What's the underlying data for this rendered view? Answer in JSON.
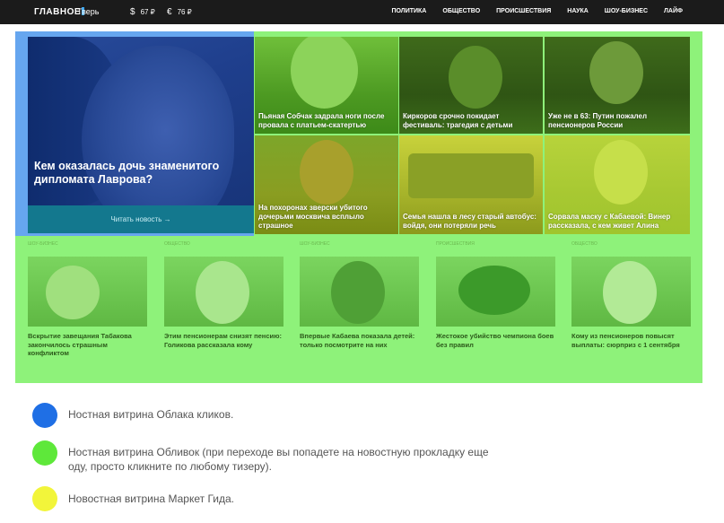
{
  "header": {
    "logo": "ГЛАВНОЕ",
    "city": "Тверь",
    "rates": [
      {
        "symbol": "$",
        "value": "67 ₽"
      },
      {
        "symbol": "€",
        "value": "76 ₽"
      }
    ],
    "nav": [
      "Политика",
      "Общество",
      "Происшествия",
      "Наука",
      "Шоу-бизнес",
      "Лайф"
    ]
  },
  "hero": {
    "title": "Кем оказалась дочь знаменитого дипломата Лаврова?",
    "button": "Читать новость →"
  },
  "tiles": [
    {
      "caption": "Пьяная Собчак задрала ноги после провала с платьем-скатертью"
    },
    {
      "caption": "Киркоров срочно покидает фестиваль: трагедия с детьми"
    },
    {
      "caption": "Уже не в 63: Путин пожалел пенсионеров России"
    },
    {
      "caption": "На похоронах зверски убитого дочерьми москвича всплыло страшное"
    },
    {
      "caption": "Семья нашла в лесу старый автобус: войдя, они потеряли речь"
    },
    {
      "caption": "Сорвала маску с Кабаевой: Винер рассказала, с кем живет Алина"
    }
  ],
  "bottom": [
    {
      "category": "Шоу-бизнес",
      "caption": "Вскрытие завещания Табакова закончилось страшным конфликтом"
    },
    {
      "category": "Общество",
      "caption": "Этим пенсионерам снизят пенсию: Голикова рассказала кому"
    },
    {
      "category": "Шоу-бизнес",
      "caption": "Впервые Кабаева показала детей: только посмотрите на них"
    },
    {
      "category": "Происшествия",
      "caption": "Жестокое убийство чемпиона боев без правил"
    },
    {
      "category": "Общество",
      "caption": "Кому из пенсионеров повысят выплаты: сюрприз с 1 сентября"
    }
  ],
  "legend": [
    {
      "color": "#1f6fe5",
      "text": "Ностная витрина Облака кликов."
    },
    {
      "color": "#5ee83a",
      "text": "Ностная витрина Обливок (при переходе вы попадете на новостную прокладку еще оду, просто кликните по любому тизеру)."
    },
    {
      "color": "#f2f53a",
      "text": "Новостная витрина Маркет Гида."
    }
  ]
}
